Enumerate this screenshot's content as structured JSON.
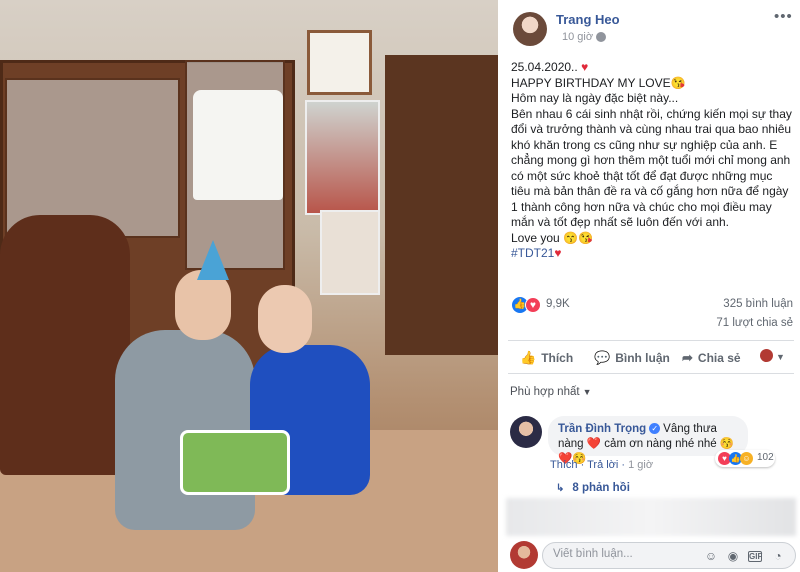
{
  "post": {
    "author": "Trang Heo",
    "time": "10 giờ",
    "privacy_icon": "globe-icon",
    "more_label": "•••",
    "lines": [
      "25.04.2020..",
      "HAPPY BIRTHDAY MY LOVE😘",
      "Hôm nay là ngày đặc biệt này...",
      "Bên nhau 6 cái sinh nhật rồi, chứng kiến mọi sự thay đổi và trưởng thành và cùng nhau trai qua bao nhiêu khó khăn trong cs cũng như sự nghiệp của anh. E chẳng mong gì hơn thêm một tuổi mới chỉ mong anh có một sức khoẻ thật tốt để đạt được những mục tiêu mà bản thân đề ra và cố gắng hơn nữa để ngày 1 thành công hơn nữa và chúc cho mọi điều may mắn và tốt đẹp nhất sẽ luôn đến với anh.",
      "Love you 😙😘"
    ],
    "hashtag": "#TDT21"
  },
  "stats": {
    "reactions": "9,9K",
    "comments": "325 bình luận",
    "shares": "71 lượt chia sẻ"
  },
  "actions": {
    "like": "Thích",
    "comment": "Bình luận",
    "share": "Chia sẻ"
  },
  "comments": {
    "sort_label": "Phù hợp nhất",
    "top": {
      "name": "Trần Đình Trọng",
      "text": "Vâng thưa nàng ❤️ cảm ơn nàng nhé nhé 😚❤️😚",
      "like": "Thích",
      "reply": "Trả lời",
      "time": "1 giờ",
      "reaction_count": "102"
    },
    "replies": "8 phản hồi"
  },
  "composer": {
    "placeholder": "Viết bình luận..."
  },
  "colors": {
    "link": "#385898",
    "like_blue": "#1877f2",
    "love_red": "#f33e58"
  }
}
